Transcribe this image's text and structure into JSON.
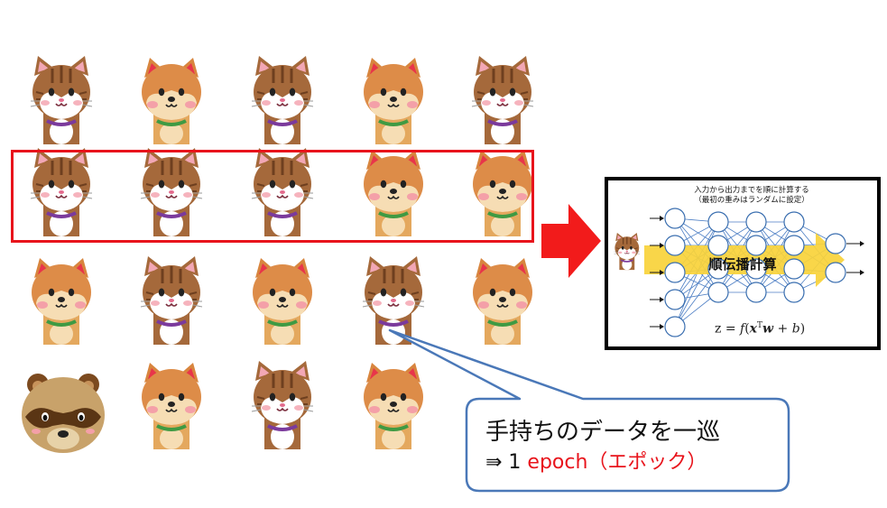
{
  "animals": [
    {
      "kind": "cat"
    },
    {
      "kind": "dog"
    },
    {
      "kind": "cat"
    },
    {
      "kind": "dog"
    },
    {
      "kind": "cat"
    },
    {
      "kind": "cat"
    },
    {
      "kind": "cat"
    },
    {
      "kind": "cat"
    },
    {
      "kind": "dog"
    },
    {
      "kind": "dog"
    },
    {
      "kind": "dog"
    },
    {
      "kind": "cat"
    },
    {
      "kind": "dog"
    },
    {
      "kind": "cat"
    },
    {
      "kind": "dog"
    },
    {
      "kind": "raccoon"
    },
    {
      "kind": "dog"
    },
    {
      "kind": "cat"
    },
    {
      "kind": "dog"
    }
  ],
  "colors": {
    "selection_border": "#e8141c",
    "arrow": "#f21b1b",
    "callout_border": "#4a78b8",
    "callout_fill": "#ffffff",
    "epoch_text": "#e8141c",
    "forward_arrow": "#f9d33a",
    "node_stroke": "#3b6fb0",
    "edge": "#4c7ec4"
  },
  "nn": {
    "caption_line1": "入力から出力までを順に計算する",
    "caption_line2": "（最初の重みはランダムに設定）",
    "forward_label": "順伝播計算",
    "formula_prefix": "z = ",
    "formula_f": "f",
    "formula_x": "x",
    "formula_T": "T",
    "formula_w": "w",
    "formula_plus": " + ",
    "formula_b": "b",
    "layers": [
      5,
      4,
      4,
      4,
      2
    ]
  },
  "callout": {
    "line1": "手持ちのデータを一巡",
    "line2_prefix": "⇛ 1 ",
    "line2_epoch": "epoch（エポック）"
  }
}
